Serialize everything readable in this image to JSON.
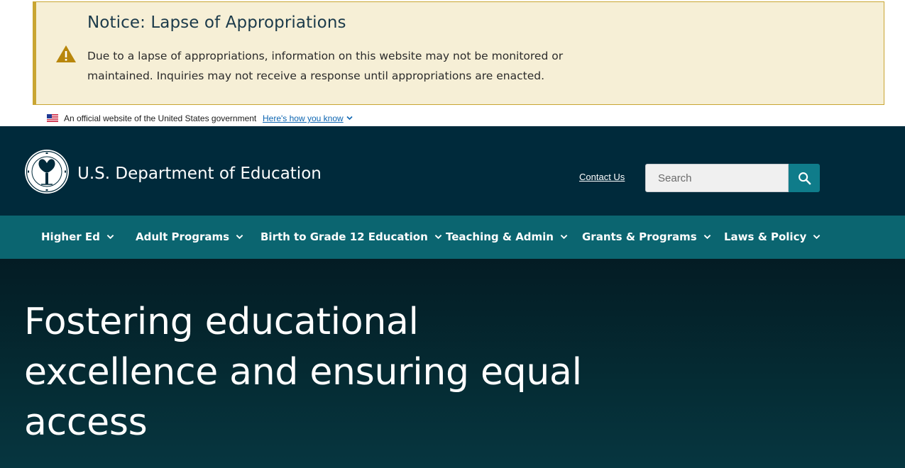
{
  "notice": {
    "title": "Notice: Lapse of Appropriations",
    "body": "Due to a lapse of appropriations, information on this website may not be monitored or maintained. Inquiries may not receive a response until appropriations are enacted.",
    "icon": "warning-icon",
    "accent_color": "#c9a532",
    "background_color": "#f6efd6"
  },
  "gov_banner": {
    "text": "An official website of the United States government",
    "link": "Here's how you know",
    "icon": "us-flag-icon"
  },
  "header": {
    "title": "U.S. Department of Education",
    "logo": "department-seal-icon",
    "contact_label": "Contact Us",
    "search_placeholder": "Search",
    "search_button_icon": "search-icon",
    "background_color": "#002a3b"
  },
  "nav": {
    "background_color": "#0b6570",
    "items": [
      {
        "label": "Higher Ed"
      },
      {
        "label": "Adult Programs"
      },
      {
        "label": "Birth to Grade 12 Education"
      },
      {
        "label": "Teaching & Admin"
      },
      {
        "label": "Grants & Programs"
      },
      {
        "label": "Laws & Policy"
      }
    ]
  },
  "hero": {
    "heading": "Fostering educational excellence and ensuring equal access"
  }
}
